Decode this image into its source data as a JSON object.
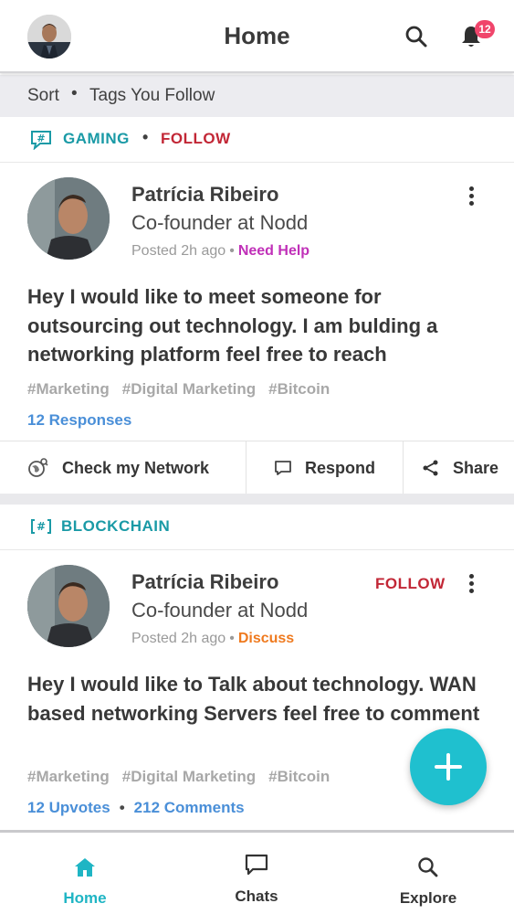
{
  "header": {
    "title": "Home",
    "notification_count": "12"
  },
  "sortbar": {
    "sort_label": "Sort",
    "separator": "•",
    "filter_label": "Tags You Follow"
  },
  "posts": [
    {
      "tag": "GAMING",
      "tag_follow": "FOLLOW",
      "author": "Patrícia Ribeiro",
      "role": "Co-founder at Nodd",
      "posted": "Posted 2h ago",
      "category": "Need Help",
      "body": "Hey I would like to meet someone for outsourcing out technology. I am bulding a networking platform feel free to reach",
      "hashtags": [
        "#Marketing",
        "#Digital Marketing",
        "#Bitcoin"
      ],
      "responses": "12 Responses",
      "actions": {
        "network": "Check my Network",
        "respond": "Respond",
        "share": "Share"
      }
    },
    {
      "tag": "BLOCKCHAIN",
      "author": "Patrícia Ribeiro",
      "author_follow": "FOLLOW",
      "role": "Co-founder at Nodd",
      "posted": "Posted 2h ago",
      "category": "Discuss",
      "body": "Hey I would like to Talk about technology. WAN based networking Servers feel free to comment",
      "hashtags": [
        "#Marketing",
        "#Digital Marketing",
        "#Bitcoin"
      ],
      "upvotes": "12 Upvotes",
      "comments": "212 Comments"
    }
  ],
  "bottom_nav": {
    "home": "Home",
    "chats": "Chats",
    "explore": "Explore"
  },
  "colors": {
    "accent": "#1fc0cf",
    "follow": "#c22736",
    "need_help": "#c030b8",
    "discuss": "#ef7a1f",
    "link": "#4a8fd8"
  }
}
